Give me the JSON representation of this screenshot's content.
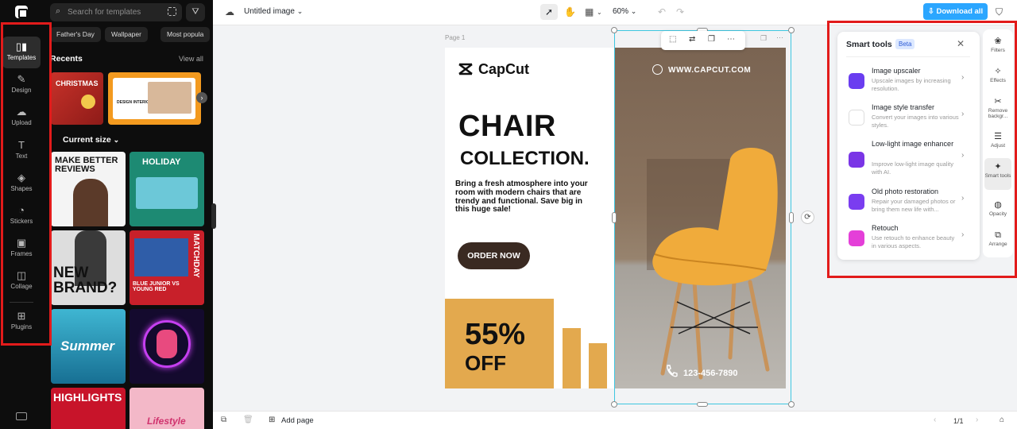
{
  "rail": {
    "items": [
      {
        "label": "Templates",
        "icon": "templates-icon",
        "glyph": "▯▮"
      },
      {
        "label": "Design",
        "icon": "design-icon",
        "glyph": "✎"
      },
      {
        "label": "Upload",
        "icon": "upload-icon",
        "glyph": "☁"
      },
      {
        "label": "Text",
        "icon": "text-icon",
        "glyph": "T"
      },
      {
        "label": "Shapes",
        "icon": "shapes-icon",
        "glyph": "◈"
      },
      {
        "label": "Stickers",
        "icon": "stickers-icon",
        "glyph": "◔"
      },
      {
        "label": "Frames",
        "icon": "frames-icon",
        "glyph": "▣"
      },
      {
        "label": "Collage",
        "icon": "collage-icon",
        "glyph": "◫"
      },
      {
        "label": "Plugins",
        "icon": "plugins-icon",
        "glyph": "⊞"
      }
    ]
  },
  "panel": {
    "search_placeholder": "Search for templates",
    "chips": [
      "Father's Day",
      "Wallpaper",
      "Most popula"
    ],
    "recents_title": "Recents",
    "view_all": "View all",
    "current_size_title": "Current size",
    "recent_thumbs": [
      "CHRISTMAS",
      "DESIGN INTERIOR"
    ],
    "templates": [
      {
        "text": "MAKE BETTER REVIEWS"
      },
      {
        "text": "HOLIDAY"
      },
      {
        "text": "NEW BRAND?"
      },
      {
        "text": "MATCHDAY",
        "sub": "BLUE JUNIOR VS YOUNG RED"
      },
      {
        "text": "Summer"
      },
      {
        "text": ""
      },
      {
        "text": "HIGHLIGHTS"
      },
      {
        "text": "Lifestyle"
      }
    ]
  },
  "topbar": {
    "doc_title": "Untitled image",
    "zoom": "60%",
    "download_label": "Download all"
  },
  "canvas": {
    "page_label": "Page 1",
    "brand": "CapCut",
    "headline1": "CHAIR",
    "headline2": "COLLECTION.",
    "description": "Bring a fresh atmosphere into your room with modern chairs that are trendy and functional. Save big in this huge sale!",
    "cta": "ORDER NOW",
    "discount_pct": "55%",
    "discount_off": "OFF",
    "url": "WWW.CAPCUT.COM",
    "phone": "123-456-7890"
  },
  "bottombar": {
    "add_page": "Add page",
    "page_count": "1/1"
  },
  "smart_tools": {
    "title": "Smart tools",
    "badge": "Beta",
    "items": [
      {
        "name": "Image upscaler",
        "desc": "Upscale images by increasing resolution.",
        "color": "#6a3df0"
      },
      {
        "name": "Image style transfer",
        "desc": "Convert your images into various styles.",
        "color": "#ffffff"
      },
      {
        "name": "Low-light image enhancer",
        "desc": "Improve low-light image quality with AI.",
        "color": "#7a35e6"
      },
      {
        "name": "Old photo restoration",
        "desc": "Repair your damaged photos or bring them new life with...",
        "color": "#7a3df0"
      },
      {
        "name": "Retouch",
        "desc": "Use retouch to enhance beauty in various aspects.",
        "color": "#e43fd8"
      }
    ]
  },
  "tool_rail": {
    "items": [
      {
        "label": "Filters",
        "glyph": "❀"
      },
      {
        "label": "Effects",
        "glyph": "✧"
      },
      {
        "label": "Remove backgr...",
        "glyph": "✂"
      },
      {
        "label": "Adjust",
        "glyph": "☰"
      },
      {
        "label": "Smart tools",
        "glyph": "✦"
      },
      {
        "label": "Opacity",
        "glyph": "◍"
      },
      {
        "label": "Arrange",
        "glyph": "⧉"
      }
    ]
  },
  "colors": {
    "accent": "#2ba6ff",
    "selection": "#3ec6e0",
    "promo_orange": "#e3a94e",
    "annotation_red": "#e21b1b"
  }
}
